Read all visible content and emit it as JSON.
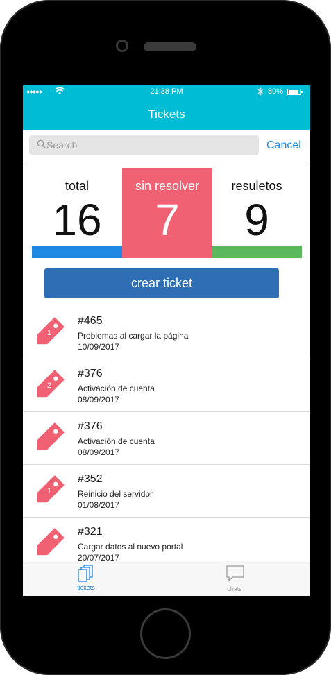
{
  "status_bar": {
    "time": "21:38 PM",
    "battery": "80%"
  },
  "nav": {
    "title": "Tickets"
  },
  "search": {
    "placeholder": "Search",
    "cancel_label": "Cancel"
  },
  "stats": {
    "total": {
      "label": "total",
      "value": "16"
    },
    "unresolved": {
      "label": "sin resolver",
      "value": "7"
    },
    "resolved": {
      "label": "resuletos",
      "value": "9"
    }
  },
  "create_button": {
    "label": "crear ticket"
  },
  "tickets": [
    {
      "badge": "1",
      "number": "#465",
      "title": "Problemas al cargar la página",
      "date": "10/09/2017"
    },
    {
      "badge": "2",
      "number": "#376",
      "title": "Activación de cuenta",
      "date": "08/09/2017"
    },
    {
      "badge": "",
      "number": "#376",
      "title": "Activación de cuenta",
      "date": "08/09/2017"
    },
    {
      "badge": "1",
      "number": "#352",
      "title": "Reinicio del servidor",
      "date": "01/08/2017"
    },
    {
      "badge": "",
      "number": "#321",
      "title": "Cargar datos al nuevo portal",
      "date": "20/07/2017"
    }
  ],
  "tabs": [
    {
      "label": "tickets",
      "icon": "tickets-icon",
      "active": true
    },
    {
      "label": "chats",
      "icon": "chat-icon",
      "active": false
    }
  ],
  "colors": {
    "header": "#00bcd4",
    "unresolved": "#f06273",
    "total_bar": "#1e88e5",
    "resolved_bar": "#5cb85c",
    "create_button": "#2f6db5",
    "tag": "#f06273"
  }
}
